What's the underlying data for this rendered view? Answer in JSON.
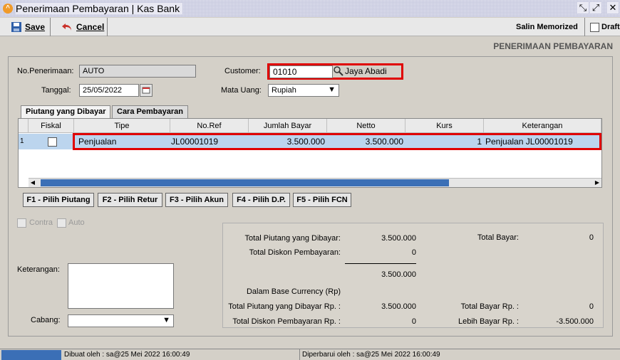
{
  "window": {
    "title": "Penerimaan Pembayaran | Kas Bank"
  },
  "toolbar": {
    "save_label": "Save",
    "cancel_label": "Cancel",
    "salin_label": "Salin Memorized",
    "draft_label": "Draft"
  },
  "header": {
    "title": "PENERIMAAN PEMBAYARAN"
  },
  "form": {
    "no_penerimaan_label": "No.Penerimaan:",
    "no_penerimaan_value": "AUTO",
    "tanggal_label": "Tanggal:",
    "tanggal_value": "25/05/2022",
    "customer_label": "Customer:",
    "customer_code": "01010",
    "customer_name": "Jaya Abadi",
    "mata_uang_label": "Mata Uang:",
    "mata_uang_value": "Rupiah"
  },
  "tabs": [
    {
      "label": "Piutang yang Dibayar"
    },
    {
      "label": "Cara Pembayaran"
    }
  ],
  "grid": {
    "columns": [
      "Fiskal",
      "Tipe",
      "No.Ref",
      "Jumlah Bayar",
      "Netto",
      "Kurs",
      "Keterangan"
    ],
    "rows": [
      {
        "num": "1",
        "tipe": "Penjualan",
        "noref": "JL00001019",
        "jumlah": "3.500.000",
        "netto": "3.500.000",
        "kurs": "1",
        "keterangan": "Penjualan JL00001019"
      }
    ]
  },
  "buttons": {
    "f1": "F1 - Pilih Piutang",
    "f2": "F2 - Pilih Retur",
    "f3": "F3 - Pilih Akun",
    "f4": "F4 - Pilih D.P.",
    "f5": "F5 - Pilih FCN"
  },
  "options": {
    "contra": "Contra",
    "auto": "Auto"
  },
  "bottom": {
    "keterangan_label": "Keterangan:",
    "cabang_label": "Cabang:"
  },
  "summary": {
    "total_piutang_label": "Total Piutang yang Dibayar:",
    "total_piutang_value": "3.500.000",
    "total_diskon_label": "Total Diskon Pembayaran:",
    "total_diskon_value": "0",
    "subtotal_value": "3.500.000",
    "base_currency_label": "Dalam Base Currency (Rp)",
    "total_piutang_rp_label": "Total Piutang yang Dibayar Rp. :",
    "total_piutang_rp_value": "3.500.000",
    "total_diskon_rp_label": "Total Diskon Pembayaran Rp. :",
    "total_diskon_rp_value": "0",
    "total_bayar_label": "Total Bayar:",
    "total_bayar_value": "0",
    "total_bayar_rp_label": "Total Bayar Rp. :",
    "total_bayar_rp_value": "0",
    "lebih_bayar_label": "Lebih Bayar Rp. :",
    "lebih_bayar_value": "-3.500.000"
  },
  "status": {
    "dibuat": "Dibuat oleh : sa@25 Mei 2022  16:00:49",
    "diperbarui": "Diperbarui oleh : sa@25 Mei 2022  16:00:49"
  }
}
